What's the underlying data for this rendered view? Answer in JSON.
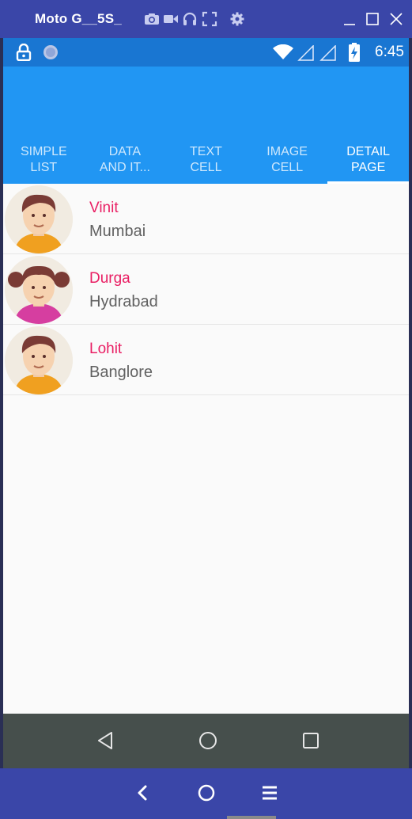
{
  "emulator": {
    "title": "Moto G__5S_",
    "toolbar_icons": [
      "camera-icon",
      "video-icon",
      "headphones-icon",
      "fullscreen-icon",
      "settings-icon"
    ],
    "window_controls": [
      "minimize-icon",
      "maximize-icon",
      "close-icon"
    ],
    "bottom_controls": [
      "back-chevron-icon",
      "home-circle-icon",
      "menu-icon"
    ]
  },
  "status_bar": {
    "time": "6:45",
    "icons": [
      "lock-icon",
      "sync-icon",
      "wifi-icon",
      "signal-icon",
      "signal-icon",
      "battery-icon"
    ]
  },
  "tabs": [
    {
      "label": "SIMPLE LIST",
      "line1": "SIMPLE",
      "line2": "LIST",
      "active": false
    },
    {
      "label": "DATA AND IT...",
      "line1": "DATA",
      "line2": "AND IT...",
      "active": false
    },
    {
      "label": "TEXT CELL",
      "line1": "TEXT",
      "line2": "CELL",
      "active": false
    },
    {
      "label": "IMAGE CELL",
      "line1": "IMAGE",
      "line2": "CELL",
      "active": false
    },
    {
      "label": "DETAIL PAGE",
      "line1": "DETAIL",
      "line2": "PAGE",
      "active": true
    }
  ],
  "list": {
    "items": [
      {
        "name": "Vinit",
        "city": "Mumbai",
        "avatar": "boy-avatar-icon"
      },
      {
        "name": "Durga",
        "city": "Hydrabad",
        "avatar": "girl-avatar-icon"
      },
      {
        "name": "Lohit",
        "city": "Banglore",
        "avatar": "boy-avatar-icon"
      }
    ]
  },
  "nav_bar": {
    "buttons": [
      "back-triangle-icon",
      "home-circle-icon",
      "recents-square-icon"
    ]
  },
  "colors": {
    "emulator_frame": "#3a46a8",
    "status_bar": "#1976d2",
    "app_bar": "#2196f3",
    "name_text": "#e91e63",
    "city_text": "#616161",
    "nav_bar": "#464f4c"
  }
}
